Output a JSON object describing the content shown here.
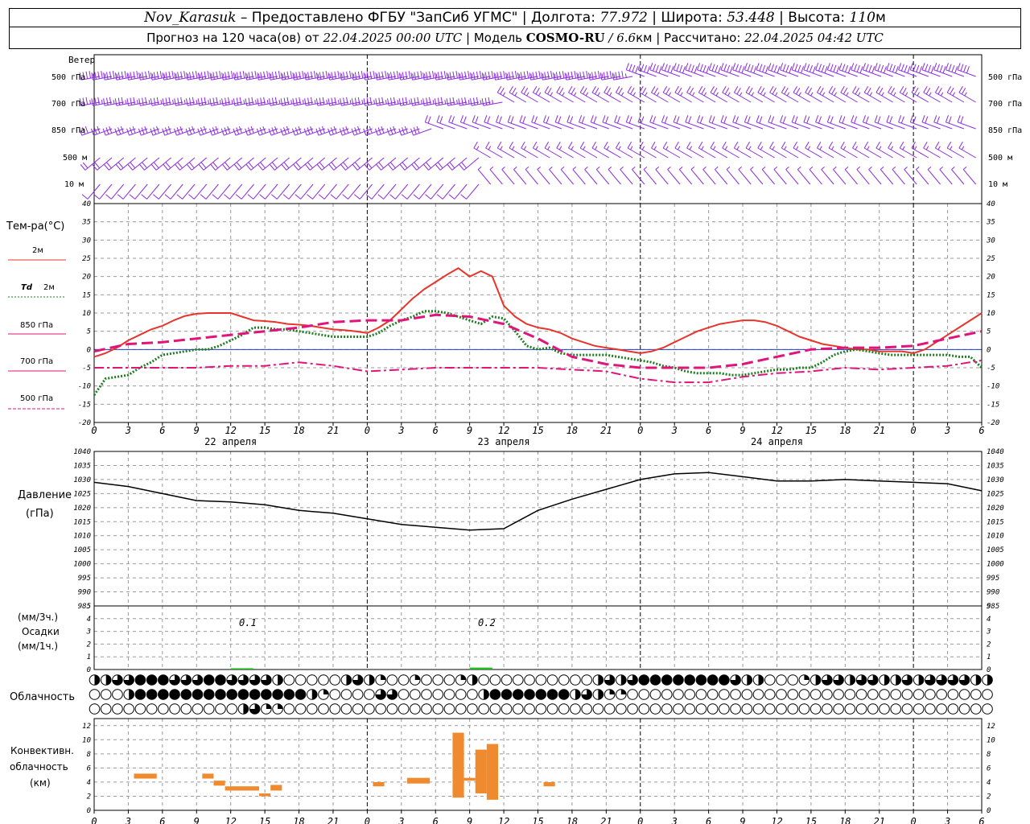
{
  "header": {
    "station": "Nov_Karasuk",
    "provider": " – Предоставлено ФГБУ \"ЗапСиб УГМС\" | Долгота: ",
    "lon": "77.972",
    "lat_label": " | Широта: ",
    "lat": "53.448",
    "alt_label": " | Высота: ",
    "alt": "110",
    "alt_unit": "м",
    "forecast_label": "Прогноз на 120 часа(ов) от ",
    "forecast_from": "22.04.2025 00:00 UTC",
    "model_label": " | Модель ",
    "model": "COSMO-RU",
    "resolution_sep": " / ",
    "resolution": "6.6",
    "resolution_unit": "км",
    "calc_label": " | Рассчитано: ",
    "calc_time": "22.04.2025 04:42 UTC"
  },
  "labels": {
    "wind": "Ветер",
    "wind_levels": [
      "500 гПа",
      "700 гПа",
      "850 гПа",
      "500 м",
      "10  м"
    ],
    "temp_title": "Тем-ра(°С)",
    "legend_2m": "2м",
    "legend_td": "Td",
    "legend_td_2m": "2м",
    "legend_850": "850 гПа",
    "legend_700": "700 гПа",
    "legend_500": "500 гПа",
    "pressure_title": "Давление",
    "pressure_unit": "(гПа)",
    "precip_unit3": "(мм/3ч.)",
    "precip_title": "Осадки",
    "precip_unit1": "(мм/1ч.)",
    "cloud_title": "Облачность",
    "conv_title1": "Конвективн.",
    "conv_title2": "облачность",
    "conv_unit": "(км)",
    "precip_total_1": "0.1",
    "precip_total_2": "0.2"
  },
  "colors": {
    "wind": "#8a2be2",
    "t2m": "#e8342a",
    "td2m": "#1e7d1e",
    "t850": "#e0147a",
    "t700": "#e0147a",
    "t500": "#e0147a",
    "pressure": "#000000",
    "precip": "#22bb22",
    "conv": "#ef8a2e",
    "zero": "#1f3fd0"
  },
  "chart_data": [
    {
      "type": "line",
      "panel": "temperature",
      "ylim": [
        -20,
        40
      ],
      "x_hours": [
        0,
        3,
        6,
        9,
        12,
        15,
        18,
        21,
        24,
        27,
        30,
        33,
        36,
        39,
        42,
        45,
        48,
        51,
        54,
        57,
        60,
        63,
        66,
        69,
        72,
        75,
        78
      ],
      "x_tick_labels": [
        "0",
        "3",
        "6",
        "9",
        "12",
        "15",
        "18",
        "21",
        "0",
        "3",
        "6",
        "9",
        "12",
        "15",
        "18",
        "21",
        "0",
        "3",
        "6",
        "9",
        "12",
        "15",
        "18",
        "21",
        "0",
        "3",
        "6"
      ],
      "date_labels": [
        "22 апреля",
        "23 апреля",
        "24 апреля"
      ],
      "series": [
        {
          "name": "2м",
          "style": "solid",
          "x": [
            0,
            1,
            2,
            3,
            4,
            5,
            6,
            7,
            8,
            9,
            10,
            11,
            12,
            13,
            14,
            15,
            16,
            17,
            18,
            19,
            20,
            21,
            22,
            23,
            24,
            25,
            26,
            27,
            28,
            29,
            30,
            31,
            32,
            33,
            34,
            35,
            36,
            37,
            38,
            39,
            40,
            41,
            42,
            43,
            44,
            45,
            46,
            47,
            48,
            49,
            50,
            51,
            52,
            53,
            54,
            55,
            56,
            57,
            58,
            59,
            60,
            61,
            62,
            63,
            64,
            65,
            66,
            67,
            68,
            69,
            70,
            71,
            72,
            73,
            74,
            75,
            76,
            77,
            78
          ],
          "values": [
            -2,
            -1,
            0.5,
            2.5,
            4,
            5.5,
            6.5,
            8,
            9.2,
            9.8,
            10,
            10,
            10,
            9,
            8,
            7.8,
            7.5,
            7,
            6.8,
            6.5,
            6,
            5.5,
            5.3,
            5,
            4.5,
            6,
            8,
            11,
            14,
            16.5,
            18.5,
            20.5,
            22.3,
            20,
            21.5,
            20,
            12,
            9,
            7,
            6,
            5.5,
            4.5,
            3,
            2,
            1,
            0.5,
            0,
            -0.5,
            -1,
            -0.5,
            0.5,
            2,
            3.5,
            5,
            6,
            7,
            7.5,
            8,
            8,
            7.5,
            6.5,
            5,
            3.5,
            2.5,
            1.5,
            1,
            0.5,
            0,
            0,
            -0.5,
            -0.5,
            -0.5,
            -1,
            0,
            2,
            4,
            6,
            8,
            10
          ]
        },
        {
          "name": "Td 2м",
          "style": "dotted",
          "x": [
            0,
            1,
            2,
            3,
            4,
            5,
            6,
            7,
            8,
            9,
            10,
            11,
            12,
            13,
            14,
            15,
            16,
            17,
            18,
            19,
            20,
            21,
            22,
            23,
            24,
            25,
            26,
            27,
            28,
            29,
            30,
            31,
            32,
            33,
            34,
            35,
            36,
            37,
            38,
            39,
            40,
            41,
            42,
            43,
            44,
            45,
            46,
            47,
            48,
            49,
            50,
            51,
            52,
            53,
            54,
            55,
            56,
            57,
            58,
            59,
            60,
            61,
            62,
            63,
            64,
            65,
            66,
            67,
            68,
            69,
            70,
            71,
            72,
            73,
            74,
            75,
            76,
            77,
            78
          ],
          "values": [
            -12.5,
            -8,
            -7.5,
            -7,
            -5,
            -3.5,
            -1.5,
            -1,
            -0.5,
            0,
            0,
            1,
            2.5,
            4,
            6,
            6,
            5.5,
            5.5,
            5,
            4.5,
            4,
            3.5,
            3.5,
            3.5,
            3.5,
            4.5,
            6.5,
            8,
            9,
            10.5,
            10.5,
            10,
            9,
            8,
            7,
            9,
            8.5,
            5,
            1,
            0,
            0.5,
            -1,
            -1.5,
            -1.5,
            -1.5,
            -1.5,
            -2,
            -2.5,
            -3,
            -3.5,
            -4.5,
            -5,
            -6,
            -6.5,
            -6.5,
            -6.5,
            -7,
            -7,
            -6.5,
            -6,
            -5.5,
            -5.5,
            -5,
            -5,
            -3.5,
            -1.5,
            -0.5,
            0,
            -0.5,
            -1,
            -1.5,
            -1.5,
            -1.5,
            -1.5,
            -1.5,
            -1.5,
            -2,
            -2,
            -5
          ]
        },
        {
          "name": "850 гПа",
          "style": "dash",
          "x": [
            0,
            3,
            6,
            9,
            12,
            15,
            18,
            21,
            24,
            27,
            30,
            33,
            36,
            39,
            42,
            45,
            48,
            51,
            54,
            57,
            60,
            63,
            66,
            69,
            72,
            75,
            78
          ],
          "values": [
            -0.5,
            1.5,
            2,
            3,
            4,
            5,
            6,
            7.5,
            8,
            8,
            9.5,
            9,
            7,
            3,
            -2,
            -4,
            -5,
            -5,
            -5,
            -4,
            -2,
            0,
            0.5,
            0.5,
            1,
            3,
            5
          ]
        },
        {
          "name": "700 гПа",
          "style": "dashdot",
          "x": [
            0,
            3,
            6,
            9,
            12,
            15,
            18,
            21,
            24,
            27,
            30,
            33,
            36,
            39,
            42,
            45,
            48,
            51,
            54,
            57,
            60,
            63,
            66,
            69,
            72,
            75,
            78
          ],
          "values": [
            -5,
            -5,
            -5,
            -5,
            -4.5,
            -4.5,
            -3.5,
            -4.5,
            -6,
            -5.5,
            -5,
            -5,
            -5,
            -5,
            -5.5,
            -6,
            -8,
            -9,
            -9,
            -7.5,
            -6.5,
            -6,
            -5,
            -5.5,
            -5,
            -4.5,
            -3
          ]
        }
      ]
    },
    {
      "type": "line",
      "panel": "pressure",
      "ylim": [
        985,
        1040
      ],
      "x": [
        0,
        3,
        6,
        9,
        12,
        15,
        18,
        21,
        24,
        27,
        30,
        33,
        36,
        39,
        42,
        45,
        48,
        51,
        54,
        57,
        60,
        63,
        66,
        69,
        72,
        75,
        78
      ],
      "values": [
        1029,
        1027.5,
        1025,
        1022.5,
        1022,
        1021,
        1019,
        1018,
        1016,
        1014,
        1013,
        1012,
        1012.5,
        1019,
        1023,
        1026.5,
        1030,
        1032,
        1032.5,
        1031,
        1029.5,
        1029.5,
        1030,
        1029.5,
        1029,
        1028.5,
        1026
      ]
    },
    {
      "type": "bar",
      "panel": "precipitation",
      "ylim": [
        0,
        5
      ],
      "bars": [
        {
          "x_start": 12,
          "x_end": 14,
          "value": 0.1
        },
        {
          "x_start": 33,
          "x_end": 35,
          "value": 0.15
        }
      ]
    },
    {
      "type": "bar",
      "panel": "convective_clouds",
      "ylim": [
        0,
        13
      ],
      "bars": [
        {
          "x": 3.5,
          "w": 2,
          "bottom": 4.5,
          "top": 5.2
        },
        {
          "x": 9.5,
          "w": 1,
          "bottom": 4.5,
          "top": 5.2
        },
        {
          "x": 10.5,
          "w": 1,
          "bottom": 3.5,
          "top": 4.2
        },
        {
          "x": 11.5,
          "w": 3,
          "bottom": 2.8,
          "top": 3.4
        },
        {
          "x": 14.5,
          "w": 1,
          "bottom": 2.0,
          "top": 2.4
        },
        {
          "x": 15.5,
          "w": 1,
          "bottom": 2.8,
          "top": 3.6
        },
        {
          "x": 24.5,
          "w": 1,
          "bottom": 3.4,
          "top": 4.0
        },
        {
          "x": 27.5,
          "w": 2,
          "bottom": 3.8,
          "top": 4.6
        },
        {
          "x": 31.5,
          "w": 1,
          "bottom": 1.8,
          "top": 11.0
        },
        {
          "x": 32.5,
          "w": 1,
          "bottom": 4.2,
          "top": 4.6
        },
        {
          "x": 33.5,
          "w": 1,
          "bottom": 2.4,
          "top": 8.6
        },
        {
          "x": 34.5,
          "w": 1,
          "bottom": 1.5,
          "top": 9.4
        },
        {
          "x": 39.5,
          "w": 1,
          "bottom": 3.4,
          "top": 4.0
        }
      ]
    },
    {
      "type": "table",
      "panel": "cloudiness",
      "legend_note": "fraction of cloud cover, 3 layers",
      "rows": [
        [
          0.5,
          0.5,
          0.75,
          0.75,
          1,
          1,
          1,
          0.75,
          0.75,
          0.75,
          1,
          1,
          0.75,
          0.75,
          0.75,
          0.75,
          0.5,
          0,
          0,
          0,
          0,
          0,
          0.5,
          0.75,
          0.5,
          0.25,
          0,
          0,
          0.25,
          0,
          0,
          0,
          0.25,
          0.5,
          0,
          0,
          0,
          0,
          0,
          0,
          0,
          0,
          0,
          0,
          0.5,
          0.75,
          0.5,
          0.75,
          1,
          1,
          1,
          1,
          1,
          1,
          1,
          1,
          0.75,
          0.5,
          0.5,
          0,
          0,
          0,
          0.25,
          0.5,
          0.75,
          0.75,
          0.5,
          0.75,
          0.75,
          0.5,
          0.5,
          0.75,
          0.5,
          0.75,
          0.75,
          0.75,
          0.75,
          0.5,
          0.5,
          0,
          0,
          0,
          0,
          0,
          0,
          0,
          0,
          0,
          0,
          0,
          0,
          0,
          0,
          0,
          0,
          0,
          0,
          0,
          0,
          0,
          0,
          0,
          0,
          0,
          0,
          0,
          0,
          0,
          0,
          0,
          0,
          0,
          0,
          0,
          0,
          0,
          0,
          0,
          0,
          0,
          0,
          0,
          0,
          0,
          0,
          0,
          0,
          0,
          0,
          0,
          0,
          0,
          0
        ],
        [
          0,
          0,
          0,
          0.5,
          1,
          1,
          1,
          1,
          1,
          1,
          1,
          1,
          1,
          1,
          1,
          1,
          1,
          1,
          1,
          0.5,
          0.25,
          0,
          0,
          0,
          0,
          0.75,
          0.75,
          0,
          0,
          0,
          0,
          0,
          0,
          0,
          0.5,
          1,
          1,
          1,
          1,
          1,
          1,
          1,
          0.5,
          0.75,
          0.5,
          0.25,
          0.25,
          0,
          0,
          0,
          0,
          0,
          0,
          0,
          0,
          0,
          0,
          0,
          0,
          0,
          0,
          0,
          0,
          0,
          0,
          0,
          0,
          0,
          0,
          0,
          0,
          0,
          0,
          0,
          0,
          0,
          0,
          0,
          0,
          0,
          0,
          0,
          0,
          0,
          0,
          0,
          0,
          0,
          0,
          0,
          0,
          0,
          0,
          0,
          0,
          0,
          0,
          0,
          0,
          0,
          0,
          0,
          0,
          0,
          0,
          0,
          0,
          0,
          0,
          0,
          0,
          0,
          0,
          0,
          0,
          0,
          0,
          0,
          0,
          0,
          0,
          0,
          0,
          0,
          0,
          0,
          0,
          0,
          0,
          0,
          0,
          0
        ],
        [
          0,
          0,
          0,
          0,
          0,
          0,
          0,
          0,
          0,
          0,
          0,
          0,
          0,
          0.5,
          0.75,
          0.25,
          0.25,
          0,
          0,
          0,
          0,
          0,
          0,
          0,
          0,
          0,
          0,
          0,
          0,
          0,
          0,
          0,
          0,
          0,
          0,
          0,
          0,
          0,
          0,
          0,
          0,
          0,
          0,
          0,
          0,
          0,
          0,
          0,
          0,
          0,
          0,
          0,
          0,
          0,
          0,
          0,
          0,
          0,
          0,
          0,
          0,
          0,
          0,
          0,
          0,
          0,
          0,
          0,
          0,
          0,
          0,
          0,
          0,
          0,
          0,
          0,
          0,
          0,
          0,
          0,
          0,
          0,
          0,
          0,
          0,
          0,
          0,
          0,
          0,
          0,
          0,
          0,
          0,
          0,
          0,
          0,
          0,
          0,
          0,
          0,
          0,
          0,
          0,
          0,
          0,
          0,
          0,
          0,
          0,
          0,
          0,
          0,
          0,
          0,
          0,
          0,
          0,
          0,
          0,
          0,
          0,
          0,
          0,
          0,
          0,
          0,
          0,
          0,
          0,
          0,
          0,
          0
        ]
      ]
    },
    {
      "type": "scatter",
      "panel": "wind",
      "note": "wind barbs at 5 levels; approximate directions in degrees and speeds in knots",
      "levels": [
        "500 гПа",
        "700 гПа",
        "850 гПа",
        "500 м",
        "10  м"
      ],
      "segments": [
        {
          "level": "500 гПа",
          "x_from": 0,
          "x_to": 48,
          "dir": 260,
          "speed": 45
        },
        {
          "level": "500 гПа",
          "x_from": 48,
          "x_to": 78,
          "dir": 290,
          "speed": 40
        },
        {
          "level": "700 гПа",
          "x_from": 0,
          "x_to": 36,
          "dir": 260,
          "speed": 35
        },
        {
          "level": "700 гПа",
          "x_from": 36,
          "x_to": 78,
          "dir": 300,
          "speed": 25
        },
        {
          "level": "850 гПа",
          "x_from": 0,
          "x_to": 30,
          "dir": 250,
          "speed": 30
        },
        {
          "level": "850 гПа",
          "x_from": 30,
          "x_to": 78,
          "dir": 290,
          "speed": 20
        },
        {
          "level": "500 м",
          "x_from": 0,
          "x_to": 34,
          "dir": 230,
          "speed": 20
        },
        {
          "level": "500 м",
          "x_from": 34,
          "x_to": 78,
          "dir": 300,
          "speed": 15
        },
        {
          "level": "10  м",
          "x_from": 0,
          "x_to": 34,
          "dir": 220,
          "speed": 10
        },
        {
          "level": "10  м",
          "x_from": 34,
          "x_to": 78,
          "dir": 320,
          "speed": 8
        }
      ]
    }
  ]
}
